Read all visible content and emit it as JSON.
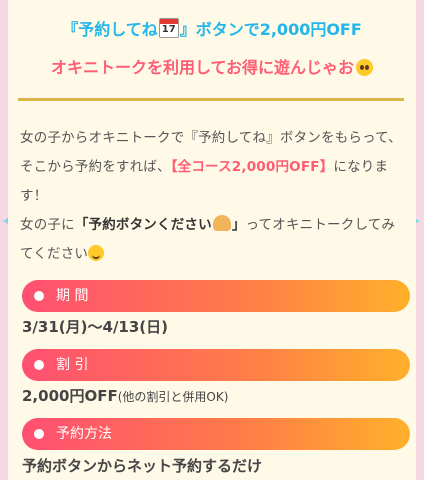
{
  "header": {
    "line1_pre": "『予約してね",
    "calendar_day": "17",
    "line1_post": "』ボタンで2,000円OFF",
    "line2": "オキニトークを利用してお得に遊んじゃお"
  },
  "body": {
    "p1_a": "女の子からオキニトークで『予約してね』ボタンをもらって、そこから予約をすれば、",
    "p1_highlight": "【全コース2,000円OFF】",
    "p1_b": "になります！",
    "p2_a": "女の子に",
    "p2_bold": "「予約ボタンください",
    "p2_bold_end": "」",
    "p2_b": "ってオキニトークしてみてください"
  },
  "sections": [
    {
      "label": "期 間",
      "value": "3/31(月)〜4/13(日)",
      "note": ""
    },
    {
      "label": "割 引",
      "value": "2,000円OFF",
      "note": "(他の割引と併用OK)"
    },
    {
      "label": "予約方法",
      "value": "予約ボタンからネット予約するだけ",
      "note": ""
    }
  ],
  "colors": {
    "headline_blue": "#23b6e8",
    "headline_red": "#ff5d73",
    "gold_line": "#d9b64a",
    "pill_gradient": [
      "#ff4f72",
      "#ffb02a"
    ]
  }
}
